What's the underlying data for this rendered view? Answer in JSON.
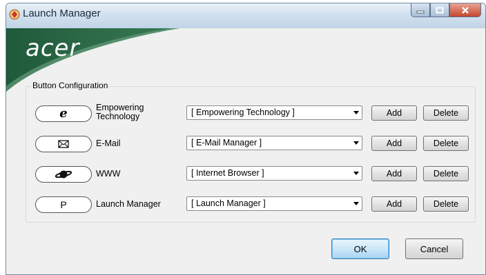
{
  "window": {
    "title": "Launch Manager",
    "controls": {
      "minimize": "minimize-icon",
      "maximize": "maximize-icon",
      "close": "close-icon"
    }
  },
  "brand": {
    "logo_text": "acer",
    "banner_color": "#2e6b4a"
  },
  "group": {
    "label": "Button Configuration"
  },
  "rows": [
    {
      "button_glyph": "e",
      "button_icon": "internet-explorer-e-icon",
      "label": "Empowering Technology",
      "selected": "[ Empowering Technology ]",
      "add": "Add",
      "delete": "Delete"
    },
    {
      "button_glyph": "✉",
      "button_icon": "envelope-icon",
      "label": "E-Mail",
      "selected": "[ E-Mail Manager ]",
      "add": "Add",
      "delete": "Delete"
    },
    {
      "button_glyph": "",
      "button_icon": "globe-icon",
      "label": "WWW",
      "selected": "[ Internet Browser ]",
      "add": "Add",
      "delete": "Delete"
    },
    {
      "button_glyph": "P",
      "button_icon": "p-key-icon",
      "label": "Launch Manager",
      "selected": "[ Launch Manager ]",
      "add": "Add",
      "delete": "Delete"
    }
  ],
  "footer": {
    "ok": "OK",
    "cancel": "Cancel"
  }
}
